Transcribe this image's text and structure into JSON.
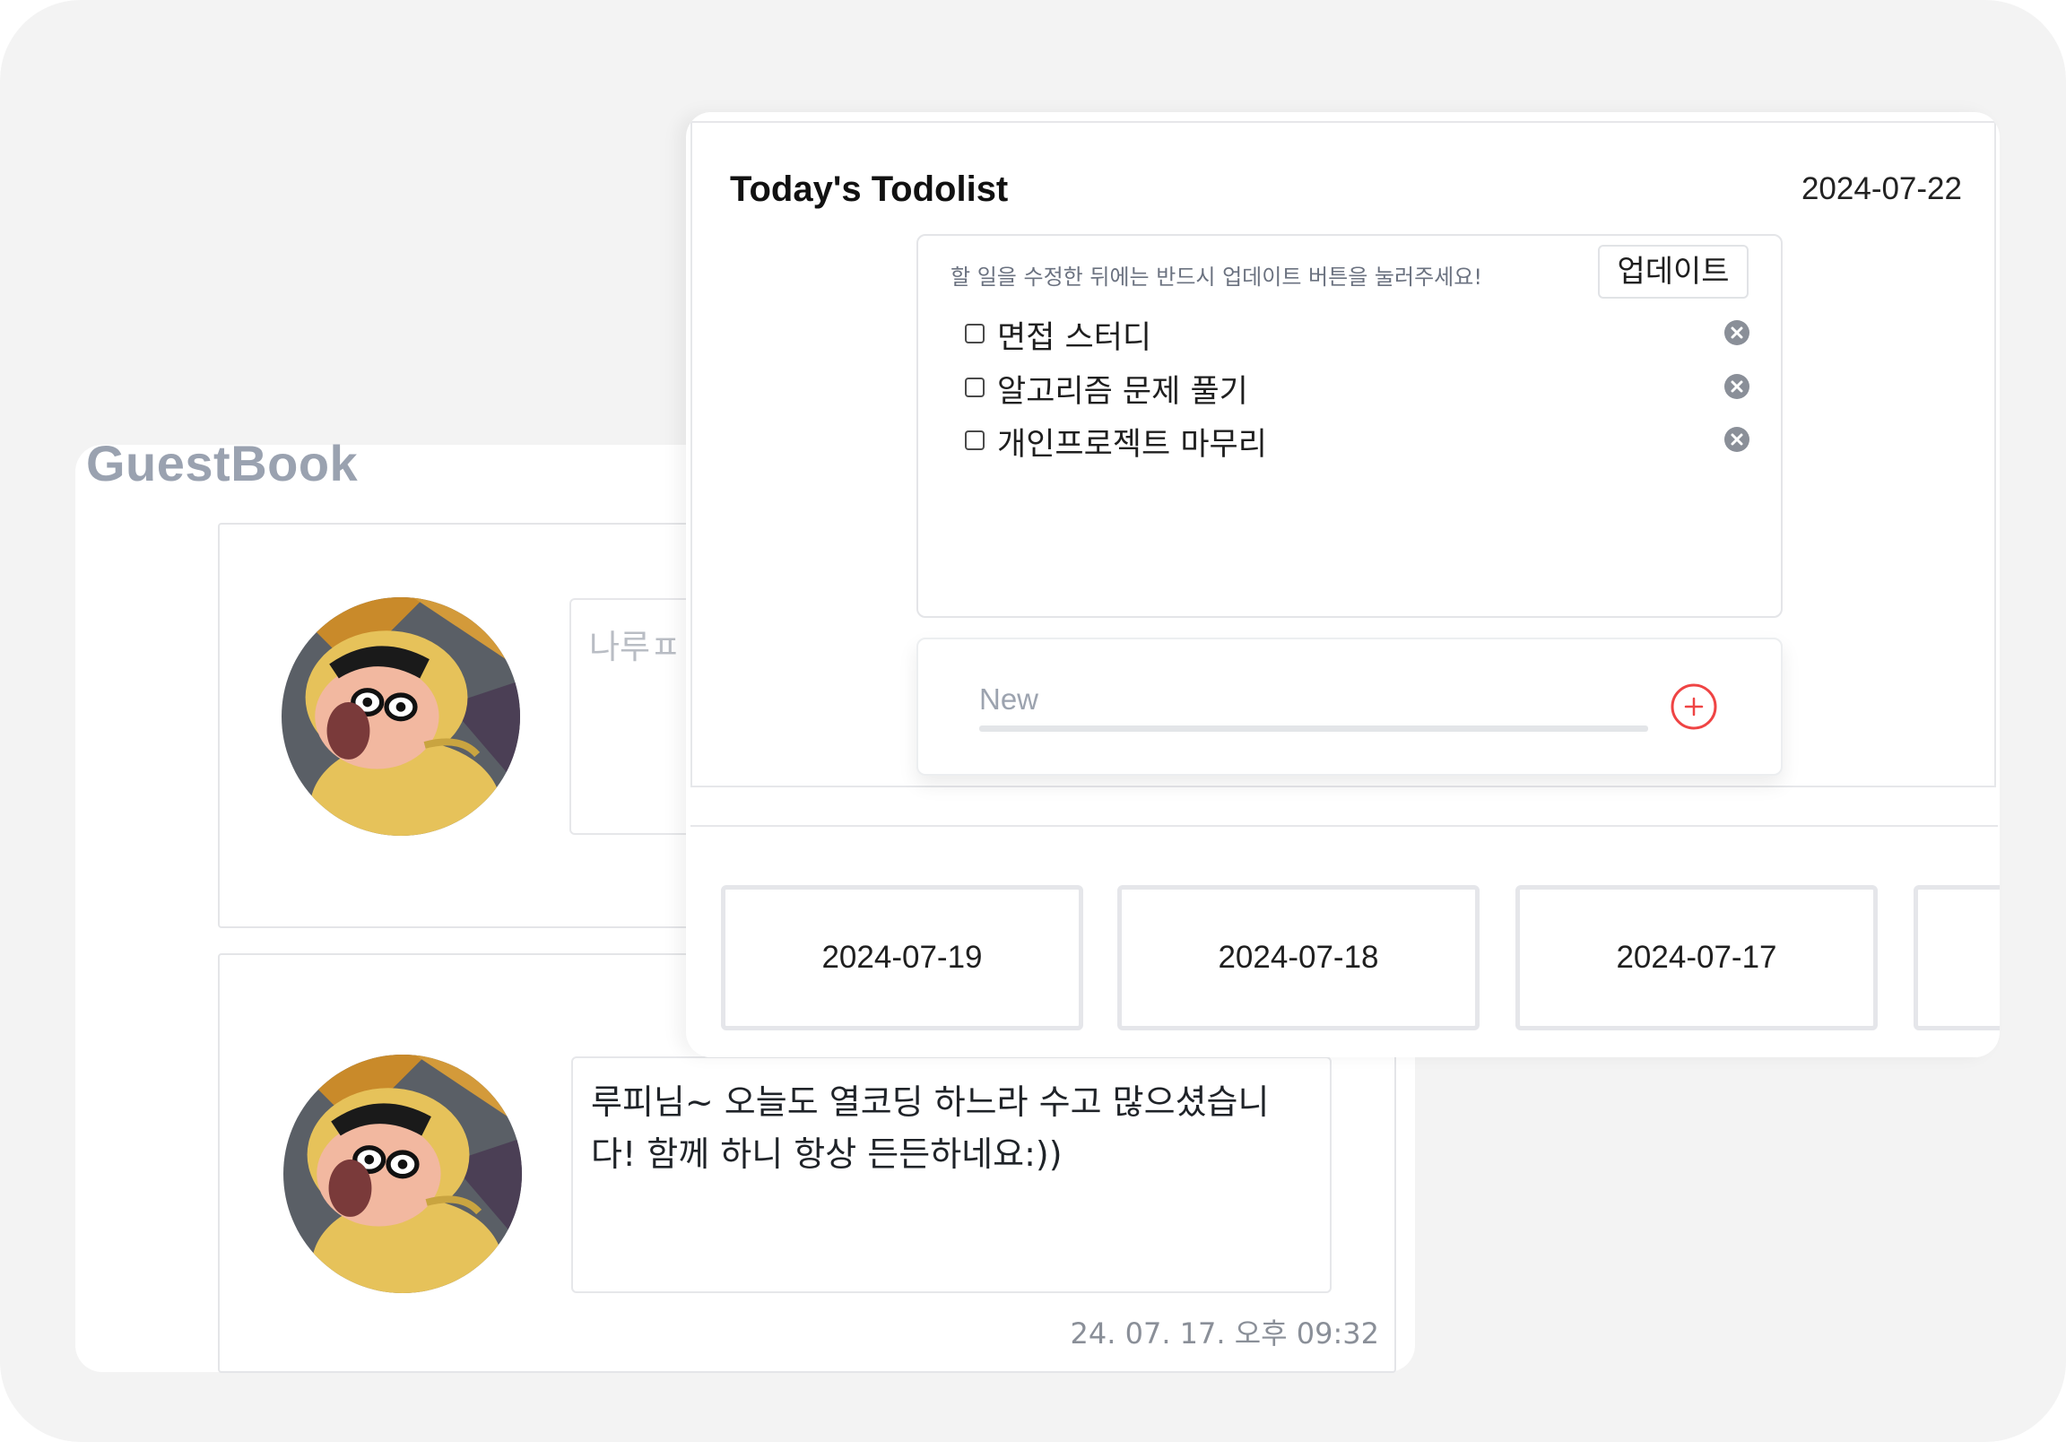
{
  "guestbook": {
    "title": "GuestBook",
    "entries": [
      {
        "message": "나루ㅍ",
        "time": ""
      },
      {
        "message": "루피님~ 오늘도 열코딩 하느라 수고 많으셨습니다! 함께 하니 항상 든든하네요:))",
        "time": "24. 07. 17. 오후 09:32"
      }
    ]
  },
  "todolist": {
    "title": "Today's Todolist",
    "date": "2024-07-22",
    "hint": "할 일을 수정한 뒤에는 반드시 업데이트 버튼을 눌러주세요!",
    "update_label": "업데이트",
    "items": [
      {
        "text": "면접 스터디",
        "checked": false
      },
      {
        "text": "알고리즘 문제 풀기",
        "checked": false
      },
      {
        "text": "개인프로젝트 마무리",
        "checked": false
      }
    ],
    "new_placeholder": "New",
    "history": [
      "2024-07-19",
      "2024-07-18",
      "2024-07-17",
      ""
    ]
  },
  "icons": {
    "delete": "close-circle-icon",
    "add": "plus-circle-icon"
  },
  "colors": {
    "accent_add": "#ef4444",
    "title_muted": "#9aa2b0"
  }
}
